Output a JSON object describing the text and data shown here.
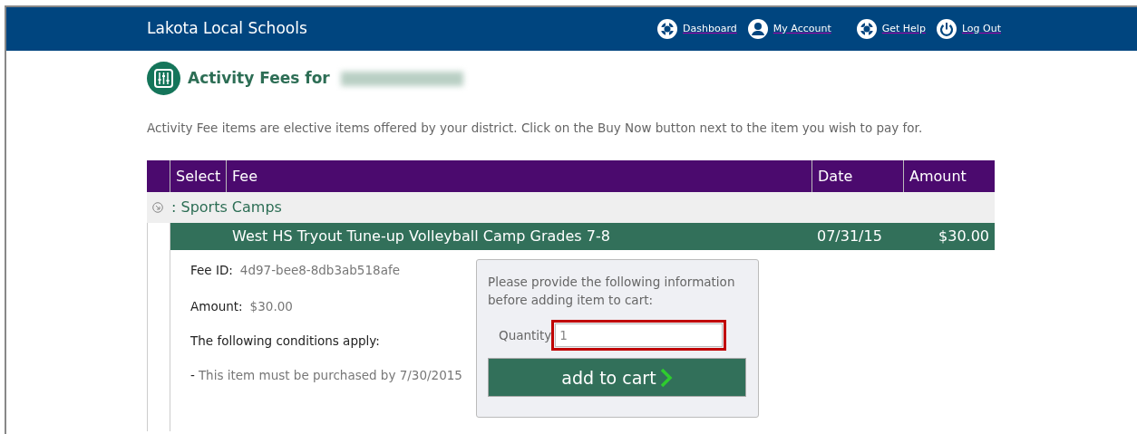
{
  "header": {
    "title": "Lakota Local Schools",
    "nav": [
      {
        "label": "Dashboard",
        "kind": "dashboard"
      },
      {
        "label": "My Account",
        "kind": "account"
      },
      {
        "label": "Get Help",
        "kind": "help"
      },
      {
        "label": "Log Out",
        "kind": "logout"
      }
    ]
  },
  "page": {
    "title": "Activity Fees for",
    "intro": "Activity Fee items are elective items offered by your district. Click on the Buy Now button next to the item you wish to pay for."
  },
  "table": {
    "columns": [
      "Select",
      "Fee",
      "Date",
      "Amount"
    ],
    "groups": [
      {
        "label": ": Sports Camps",
        "items": [
          {
            "fee": "West HS Tryout Tune-up Volleyball Camp Grades 7-8",
            "date": "07/31/15",
            "amount": "$30.00",
            "expanded": true,
            "details": {
              "fee_id_label": "Fee ID:",
              "fee_id": "4d97-bee8-8db3ab518afe",
              "amount_label": "Amount:",
              "amount": "$30.00",
              "conditions_label": "The following conditions apply:",
              "condition_prefix": "-",
              "condition": "This item must be purchased by 7/30/2015"
            }
          }
        ]
      }
    ]
  },
  "popup": {
    "message": "Please provide the following information before adding item to cart:",
    "quantity_label": "Quantity",
    "quantity": "1",
    "button": "add to cart"
  }
}
